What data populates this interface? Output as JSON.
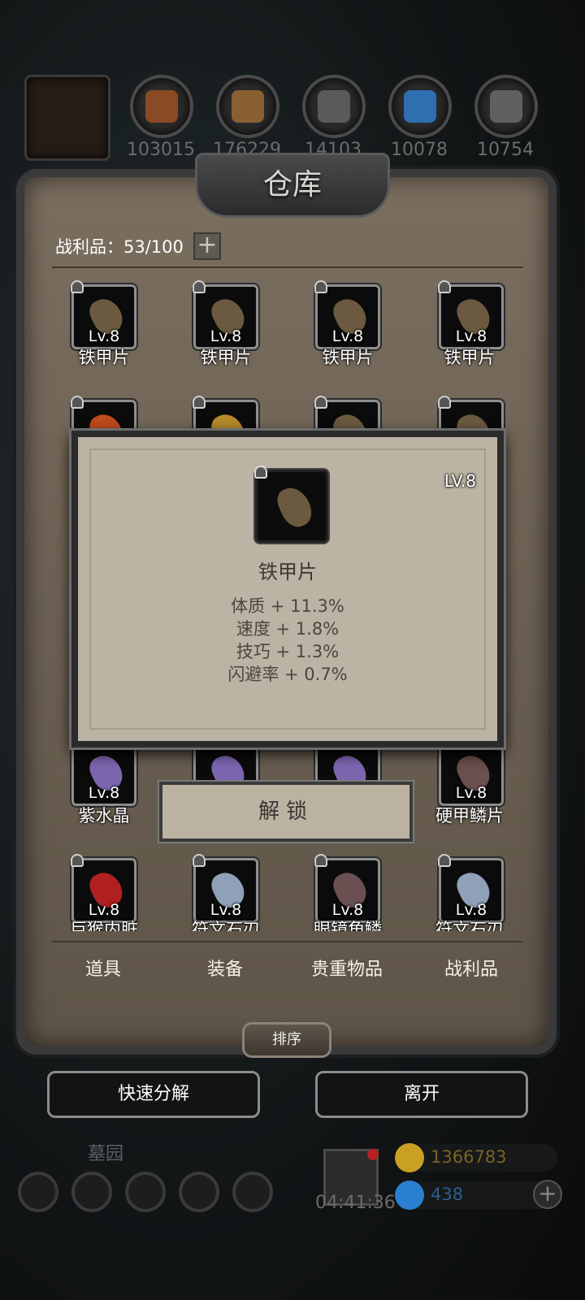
{
  "resources": [
    {
      "icon": "meat-icon",
      "count": "103015",
      "color": "#8a4a24"
    },
    {
      "icon": "wood-icon",
      "count": "176229",
      "color": "#8a6033"
    },
    {
      "icon": "stone-icon",
      "count": "14103",
      "color": "#5a5a5a"
    },
    {
      "icon": "crystal-icon",
      "count": "10078",
      "color": "#2f6fb0"
    },
    {
      "icon": "iron-icon",
      "count": "10754",
      "color": "#606060"
    }
  ],
  "panel": {
    "title": "仓库",
    "loot_capacity": "战利品：53/100"
  },
  "items": [
    {
      "name": "铁甲片",
      "level": "Lv.8",
      "color": "#6b5a40"
    },
    {
      "name": "铁甲片",
      "level": "Lv.8",
      "color": "#6b5a40"
    },
    {
      "name": "铁甲片",
      "level": "Lv.8",
      "color": "#6b5a40"
    },
    {
      "name": "铁甲片",
      "level": "Lv.8",
      "color": "#6b5a40"
    },
    {
      "name": "紫水晶",
      "level": "Lv.8",
      "color": "#7d66b0"
    },
    {
      "name": "",
      "level": "",
      "color": "#7d66b0"
    },
    {
      "name": "",
      "level": "",
      "color": "#7d66b0"
    },
    {
      "name": "硬甲鳞片",
      "level": "Lv.8",
      "color": "#6a5050"
    },
    {
      "name": "巨猴内脏",
      "level": "Lv.8",
      "color": "#b02020"
    },
    {
      "name": "符文石刃",
      "level": "Lv.8",
      "color": "#8fa0b8"
    },
    {
      "name": "眼镜角鳞",
      "level": "Lv.8",
      "color": "#6a5050"
    },
    {
      "name": "符文石刃",
      "level": "Lv.8",
      "color": "#8fa0b8"
    }
  ],
  "tooltip": {
    "level": "LV.8",
    "name": "铁甲片",
    "stats": [
      "体质 + 11.3%",
      "速度 + 1.8%",
      "技巧 + 1.3%",
      "闪避率 + 0.7%"
    ],
    "unlock_label": "解锁"
  },
  "tabs": [
    "道具",
    "装备",
    "贵重物品",
    "战利品"
  ],
  "sort_label": "排序",
  "actions": {
    "decompose": "快速分解",
    "leave": "离开"
  },
  "hud": {
    "location": "墓园",
    "timer": "04:41:36",
    "gold": "1366783",
    "gems": "438",
    "gold_color": "#c9a024",
    "gem_color": "#2a7fd0"
  }
}
